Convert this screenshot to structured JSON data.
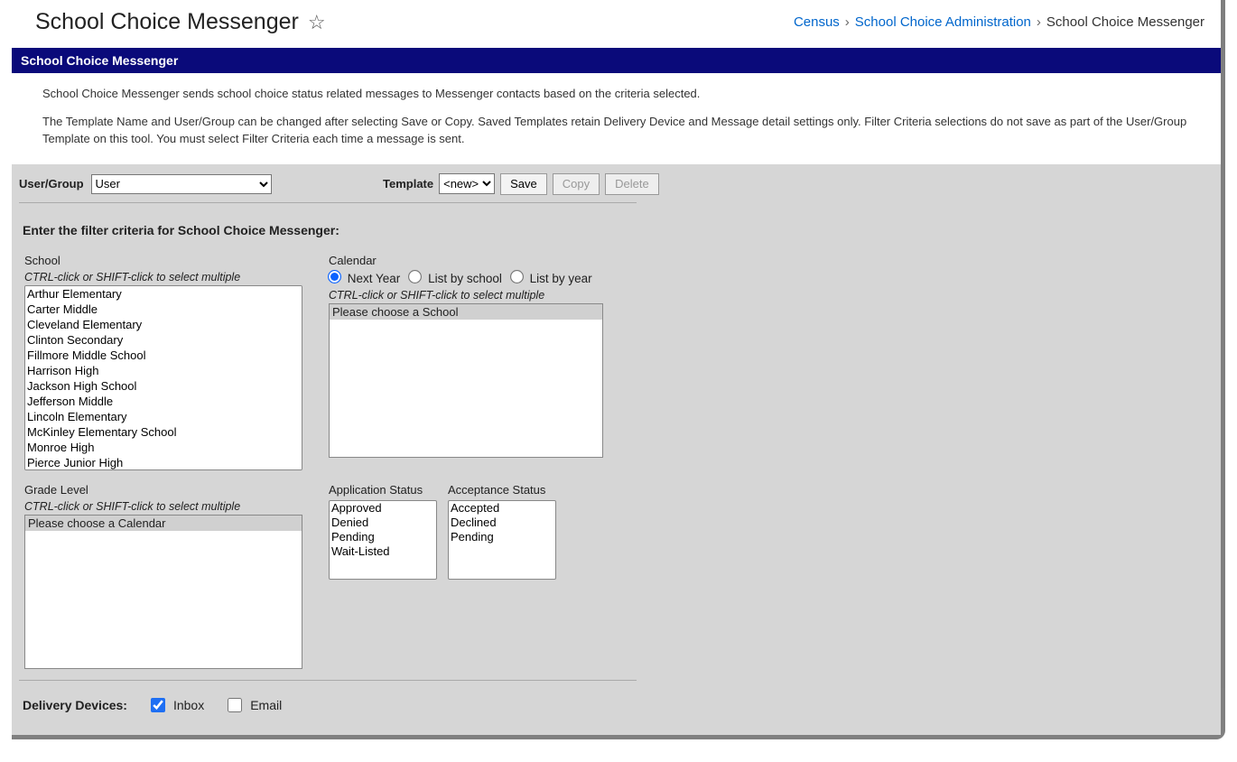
{
  "header": {
    "title": "School Choice Messenger",
    "breadcrumb": {
      "items": [
        {
          "label": "Census",
          "link": true
        },
        {
          "label": "School Choice Administration",
          "link": true
        },
        {
          "label": "School Choice Messenger",
          "link": false
        }
      ]
    }
  },
  "section_title": "School Choice Messenger",
  "description": {
    "p1": "School Choice Messenger sends school choice status related messages to Messenger contacts based on the criteria selected.",
    "p2": "The Template Name and User/Group can be changed after selecting Save or Copy. Saved Templates retain Delivery Device and Message detail settings only. Filter Criteria selections do not save as part of the User/Group Template on this tool. You must select Filter Criteria each time a message is sent."
  },
  "toolbar": {
    "ug_label": "User/Group",
    "ug_value": "User",
    "template_label": "Template",
    "template_value": "<new>",
    "save": "Save",
    "copy": "Copy",
    "delete": "Delete"
  },
  "filter_title": "Enter the filter criteria for School Choice Messenger:",
  "hint": "CTRL-click or SHIFT-click to select multiple",
  "school": {
    "label": "School",
    "options": [
      "Arthur Elementary",
      "Carter Middle",
      "Cleveland Elementary",
      "Clinton Secondary",
      "Fillmore Middle School",
      "Harrison High",
      "Jackson High School",
      "Jefferson Middle",
      "Lincoln Elementary",
      "McKinley Elementary School",
      "Monroe High",
      "Pierce Junior High"
    ]
  },
  "calendar": {
    "label": "Calendar",
    "radios": {
      "next_year": "Next Year",
      "by_school": "List by school",
      "by_year": "List by year"
    },
    "placeholder": "Please choose a School"
  },
  "grade": {
    "label": "Grade Level",
    "placeholder": "Please choose a Calendar"
  },
  "app_status": {
    "label": "Application Status",
    "options": [
      "Approved",
      "Denied",
      "Pending",
      "Wait-Listed"
    ]
  },
  "acc_status": {
    "label": "Acceptance Status",
    "options": [
      "Accepted",
      "Declined",
      "Pending"
    ]
  },
  "delivery": {
    "label": "Delivery Devices:",
    "inbox": "Inbox",
    "email": "Email"
  }
}
